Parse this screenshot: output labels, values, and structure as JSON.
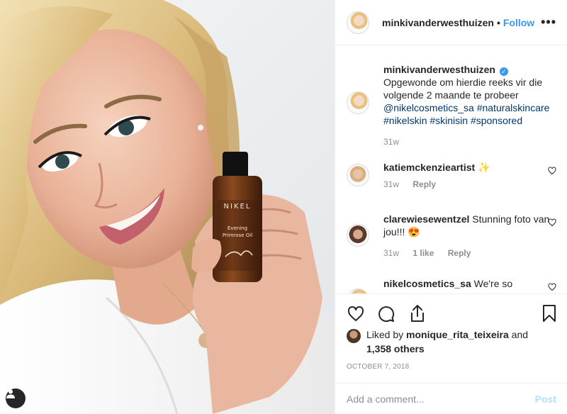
{
  "post": {
    "username": "minkivanderwesthuizen",
    "separator": "•",
    "follow_label": "Follow",
    "more_label": "•••",
    "caption": {
      "username": "minkivanderwesthuizen",
      "text": "Opgewonde om hierdie reeks vir die volgende 2 maande te probeer",
      "tags": "@nikelcosmetics_sa #naturalskincare #nikelskin #skinisin #sponsored",
      "time": "31w"
    },
    "comments": [
      {
        "username": "katiemckenzieartist",
        "text": "✨",
        "time": "31w",
        "reply_label": "Reply"
      },
      {
        "username": "clarewiesewentzel",
        "text": "Stunning foto van jou!!! 😍",
        "time": "31w",
        "likes": "1 like",
        "reply_label": "Reply"
      },
      {
        "username": "nikelcosmetics_sa",
        "text": "We're so"
      }
    ],
    "liked_by": {
      "prefix": "Liked by",
      "user": "monique_rita_teixeira",
      "and": "and",
      "others": "1,358 others"
    },
    "date": "OCTOBER 7, 2018",
    "add_comment_placeholder": "Add a comment...",
    "post_label": "Post"
  },
  "photo": {
    "bottle_brand": "NIKEL",
    "bottle_product_line1": "Evening",
    "bottle_product_line2": "Primrose Oil"
  },
  "colors": {
    "link": "#3897f0",
    "tag": "#00376b",
    "muted": "#8e8e8e",
    "post_disabled": "#b2dffc"
  }
}
